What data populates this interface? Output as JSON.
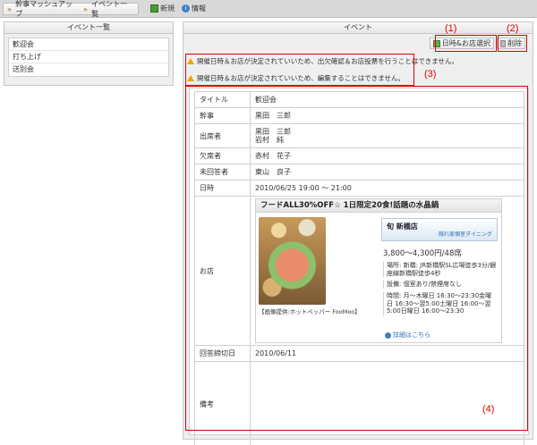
{
  "breadcrumb": {
    "home": "幹事マッシュアップ",
    "current": "イベント一覧"
  },
  "topnav": {
    "new": "新規",
    "info": "情報"
  },
  "sidebar": {
    "title": "イベント一覧",
    "items": [
      "歓迎会",
      "打ち上げ",
      "送別会"
    ]
  },
  "main": {
    "title": "イベント",
    "btn_select": "日時&お店選択",
    "btn_delete": "削除",
    "warn1": "開催日時＆お店が決定されていいため、出欠確認＆お店投票を行うことはできません。",
    "warn2": "開催日時＆お店が決定されていいため、編集することはできません。"
  },
  "annotations": {
    "a1": "(1)",
    "a2": "(2)",
    "a3": "(3)",
    "a4": "(4)"
  },
  "detail": {
    "title_label": "タイトル",
    "title_value": "歓迎会",
    "organizer_label": "幹事",
    "organizer_value": "黒田　三郎",
    "attendees_label": "出席者",
    "attendees": [
      "黒田　三郎",
      "岩村　純"
    ],
    "absent_label": "欠席者",
    "absent_value": "赤村　花子",
    "unanswered_label": "未回答者",
    "unanswered_value": "東山　良子",
    "datetime_label": "日時",
    "datetime_value": "2010/06/25 19:00 ～ 21:00",
    "shop_label": "お店",
    "deadline_label": "回答締切日",
    "deadline_value": "2010/06/11",
    "notes_label": "備考"
  },
  "shop": {
    "headline": "フードALL30%OFF☆ 1日限定20食!話題の水晶鍋",
    "name": "旬 新橋店",
    "subtitle": "隠れ家個室ダイニング",
    "price": "3,800～4,300円/48席",
    "address": "場所: 新橋: JR新橋駅SL広場徒歩3分/銀座線新橋駅徒歩4秒",
    "facility": "設備: 個室あり/禁煙席なし",
    "hours": "時間: 月～木曜日 16:30～23:30金曜日 16:30～翌5:00土曜日 16:00～翌5:00日曜日 16:00～23:30",
    "more": "詳細はこちら",
    "credit": "【画像提供:ホットペッパー FooMoo】"
  }
}
